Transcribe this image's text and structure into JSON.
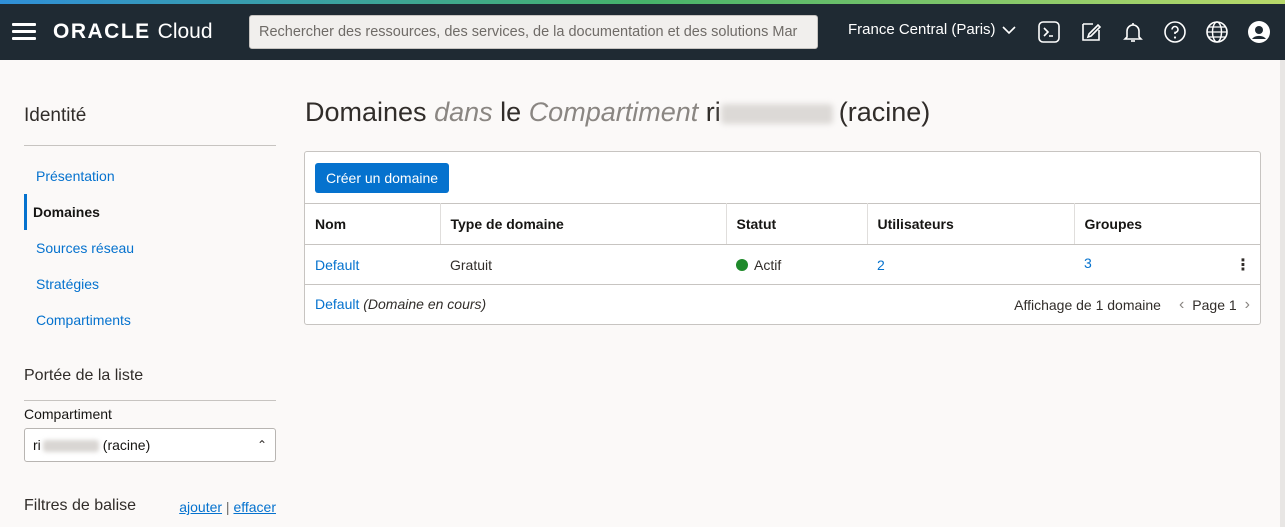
{
  "header": {
    "brand": "ORACLE",
    "product": "Cloud",
    "search_placeholder": "Rechercher des ressources, des services, de la documentation et des solutions Mar",
    "region": "France Central (Paris)",
    "icons": [
      "cloud-shell-icon",
      "edit-icon",
      "bell-icon",
      "help-icon",
      "globe-icon",
      "user-icon"
    ]
  },
  "sidebar": {
    "title": "Identité",
    "items": [
      {
        "label": "Présentation",
        "active": false
      },
      {
        "label": "Domaines",
        "active": true
      },
      {
        "label": "Sources réseau",
        "active": false
      },
      {
        "label": "Stratégies",
        "active": false
      },
      {
        "label": "Compartiments",
        "active": false
      }
    ],
    "scope_title": "Portée de la liste",
    "compartment_label": "Compartiment",
    "compartment_prefix": "ri",
    "compartment_suffix": "(racine)",
    "tag_title": "Filtres de balise",
    "tag_add": "ajouter",
    "tag_sep": "|",
    "tag_clear": "effacer"
  },
  "main": {
    "title_part1": "Domaines",
    "title_part2": "dans",
    "title_part3": "le",
    "title_part4": "Compartiment",
    "title_part5": "ri",
    "title_part6": "(racine)",
    "create_button": "Créer un domaine",
    "columns": [
      "Nom",
      "Type de domaine",
      "Statut",
      "Utilisateurs",
      "Groupes"
    ],
    "rows": [
      {
        "name": "Default",
        "type": "Gratuit",
        "status": "Actif",
        "users": "2",
        "groups": "3"
      }
    ],
    "footer_domain": "Default",
    "footer_note": "(Domaine en cours)",
    "footer_count": "Affichage de 1 domaine",
    "page_label": "Page 1"
  },
  "colors": {
    "header_bg": "#1f2a33",
    "accent": "#0572ce",
    "status_active": "#1f8a2b"
  }
}
